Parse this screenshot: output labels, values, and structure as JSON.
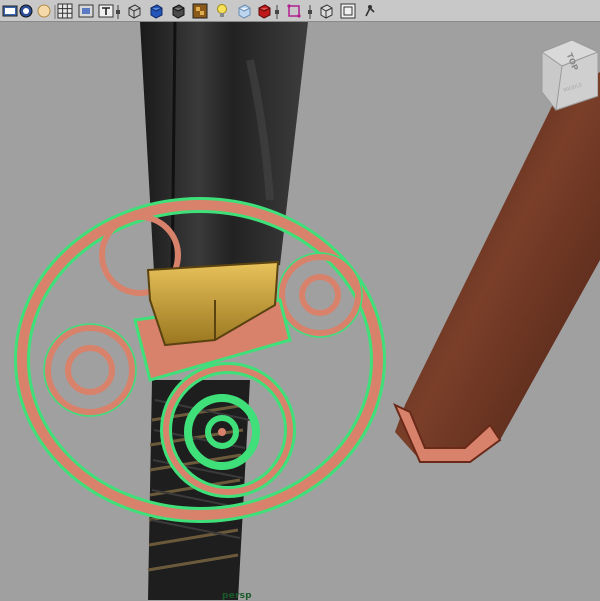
{
  "toolbar": {
    "tools": [
      {
        "name": "select-camera-icon"
      },
      {
        "name": "camera-attributes-icon"
      },
      {
        "name": "image-plane-icon"
      },
      {
        "name": "grid-icon"
      },
      {
        "name": "film-gate-icon"
      },
      {
        "name": "resolution-gate-icon"
      },
      {
        "name": "wireframe-icon"
      },
      {
        "name": "smooth-shade-icon"
      },
      {
        "name": "default-material-icon"
      },
      {
        "name": "textured-icon"
      },
      {
        "name": "use-all-lights-icon"
      },
      {
        "name": "shadows-icon"
      },
      {
        "name": "xray-icon"
      },
      {
        "name": "xray-active-components-icon"
      },
      {
        "name": "isolate-select-icon"
      },
      {
        "name": "wireframe-on-shaded-icon"
      },
      {
        "name": "hud-icon"
      },
      {
        "name": "constrain-icon"
      }
    ]
  },
  "viewport": {
    "camera": "persp",
    "viewcube_face": "TOP",
    "viewcube_side": "MIDDLE"
  },
  "colors": {
    "background": "#a0a0a0",
    "selection_wire": "#3fe07a",
    "guard_copper": "#d9826b",
    "blade": "#2b2b2b",
    "collar_gold": "#c9a13a",
    "scabbard": "#6a3422",
    "camera_label": "#1a5a2a"
  }
}
